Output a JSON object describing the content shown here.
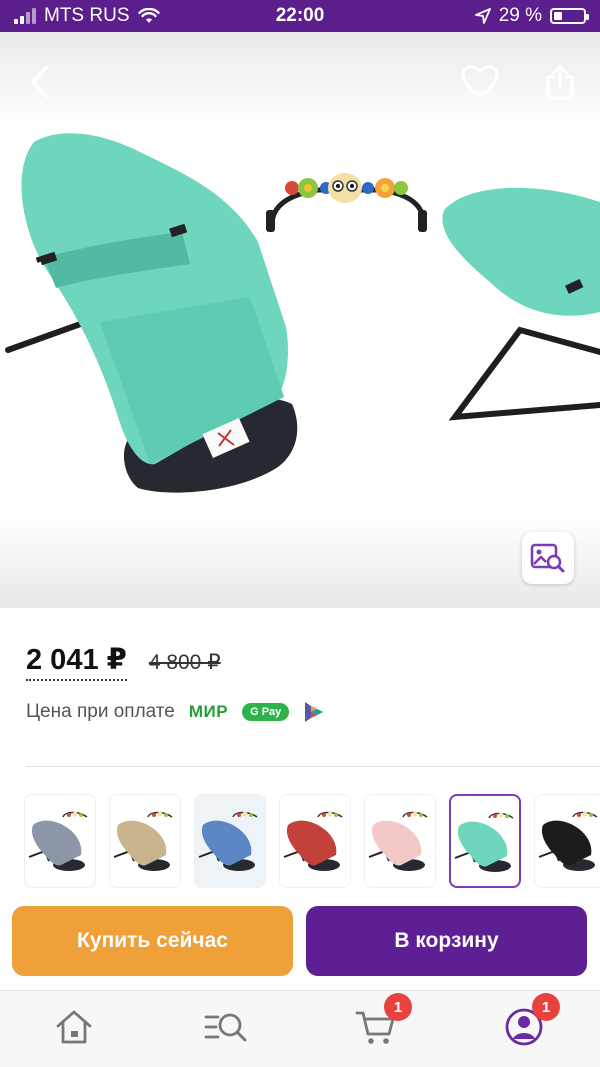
{
  "status_bar": {
    "carrier": "MTS RUS",
    "time": "22:00",
    "battery": "29 %",
    "battery_level": 0.29
  },
  "header": {
    "back_icon": "chevron-left-icon",
    "favorite_icon": "heart-icon",
    "share_icon": "share-icon"
  },
  "gallery": {
    "zoom_icon": "image-search-icon"
  },
  "price": {
    "current": "2 041 ₽",
    "old": "4 800 ₽",
    "payment_label": "Цена при оплате",
    "mir_logo": "МИР",
    "gpay_logo": "G Pay"
  },
  "variants": {
    "selected_index": 5,
    "items": [
      {
        "color": "#8d97a8"
      },
      {
        "color": "#c9b48e"
      },
      {
        "color": "#5c87c4"
      },
      {
        "color": "#c4403a"
      },
      {
        "color": "#f2c9c6"
      },
      {
        "color": "#6dd6bd"
      },
      {
        "color": "#1c1c1c"
      }
    ]
  },
  "actions": {
    "buy_now": "Купить сейчас",
    "add_to_cart": "В корзину"
  },
  "bottom_nav": {
    "home_icon": "home-icon",
    "catalog_icon": "search-list-icon",
    "cart_icon": "cart-icon",
    "cart_badge": "1",
    "profile_icon": "profile-icon",
    "profile_badge": "1"
  },
  "colors": {
    "brand_purple": "#5e1f94",
    "buy_orange": "#f0a039",
    "badge_red": "#e8423f",
    "mint": "#6dd6bd"
  }
}
